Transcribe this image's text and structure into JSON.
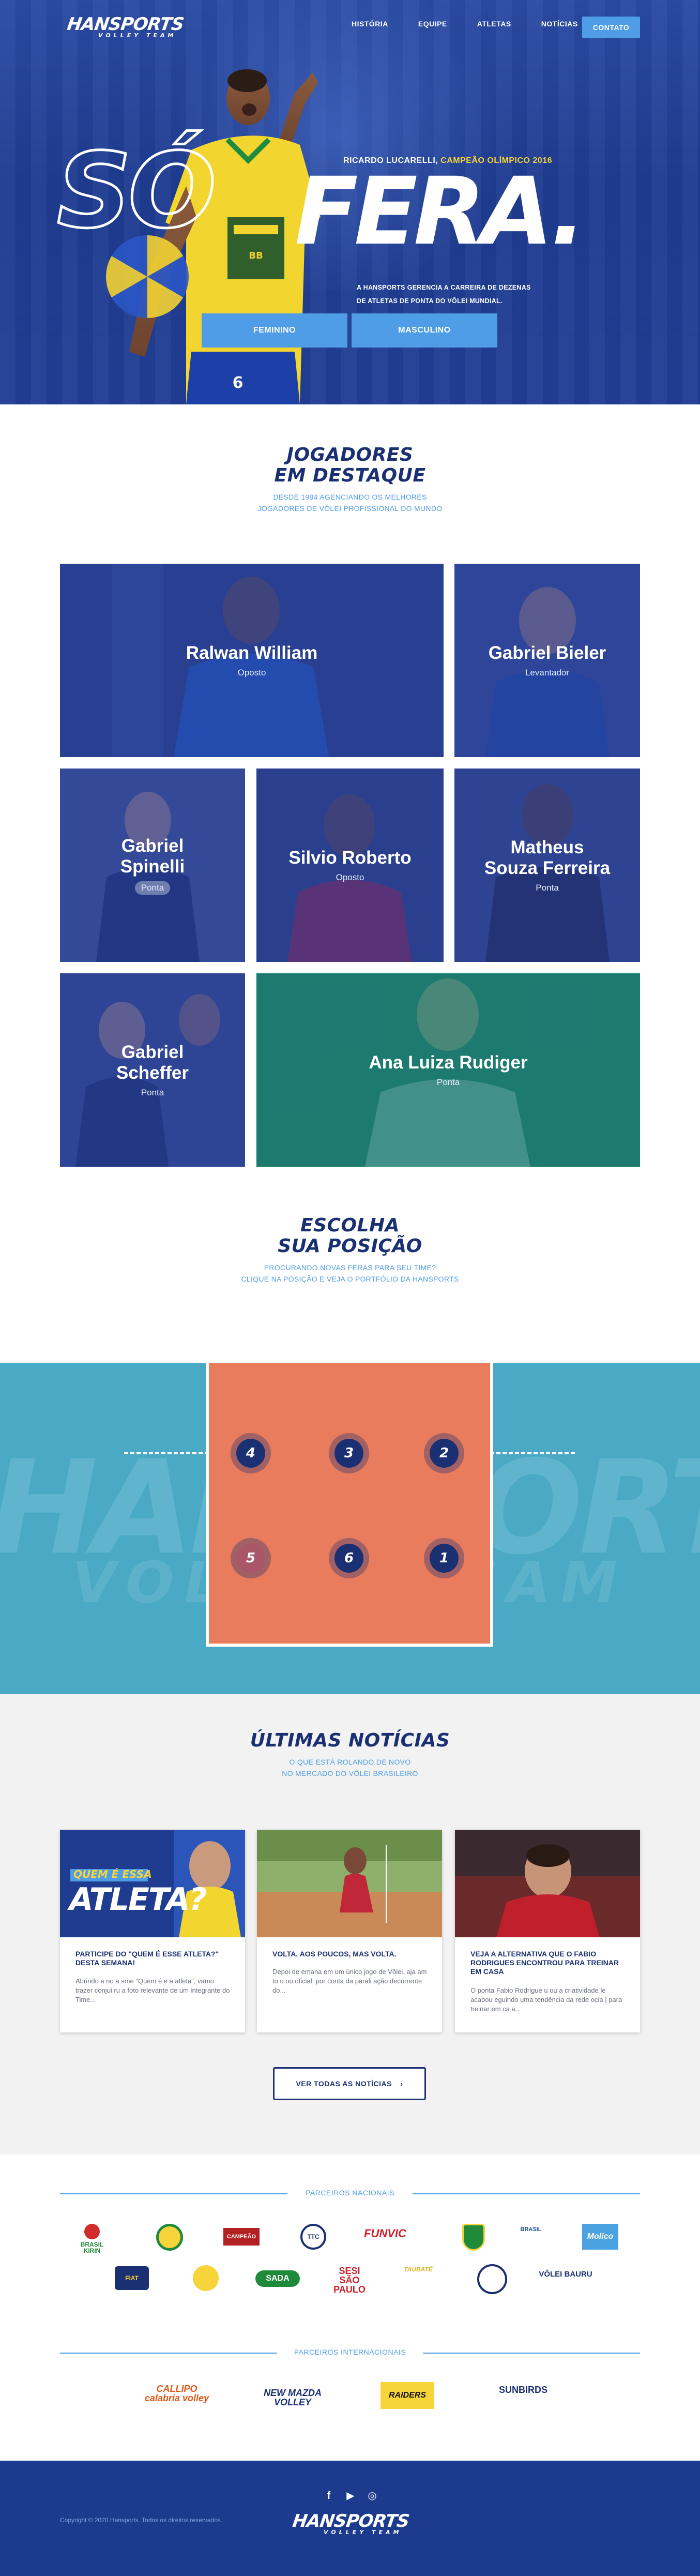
{
  "header": {
    "logo_main": "HANSPORTS",
    "logo_sub": "VOLLEY TEAM",
    "nav": [
      "HISTÓRIA",
      "EQUIPE",
      "ATLETAS",
      "NOTÍCIAS"
    ],
    "contact_label": "CONTATO"
  },
  "hero": {
    "word_outline": "SÓ",
    "word_solid": "FERA.",
    "tag_name": "RICARDO LUCARELLI, ",
    "tag_highlight": "CAMPEÃO OLÍMPICO 2016",
    "description_line1": "A HANSPORTS GERENCIA A CARREIRA DE DEZENAS",
    "description_line2": "DE ATLETAS DE PONTA DO VÔLEI MUNDIAL.",
    "button_female": "FEMININO",
    "button_male": "MASCULINO"
  },
  "featured": {
    "title_line1": "JOGADORES",
    "title_line2": "EM DESTAQUE",
    "subtitle_line1": "DESDE 1994 AGENCIANDO OS MELHORES",
    "subtitle_line2": "JOGADORES DE VÔLEI PROFISSIONAL DO MUNDO",
    "players": [
      {
        "name": "Ralwan William",
        "position": "Oposto"
      },
      {
        "name": "Gabriel Bieler",
        "position": "Levantador"
      },
      {
        "name_line1": "Gabriel",
        "name_line2": "Spinelli",
        "position": "Ponta"
      },
      {
        "name": "Silvio Roberto",
        "position": "Oposto"
      },
      {
        "name_line1": "Matheus",
        "name_line2": "Souza Ferreira",
        "position": "Ponta"
      },
      {
        "name_line1": "Gabriel",
        "name_line2": "Scheffer",
        "position": "Ponta"
      },
      {
        "name": "Ana Luiza Rudiger",
        "position": "Ponta"
      }
    ]
  },
  "positions": {
    "title_line1": "ESCOLHA",
    "title_line2": "SUA POSIÇÃO",
    "subtitle_line1": "PROCURANDO NOVAS FERAS PARA SEU TIME?",
    "subtitle_line2": "CLIQUE NA POSIÇÃO E VEJA O PORTFÓLIO DA HANSPORTS",
    "watermark": "HANSPORTS",
    "watermark_sub": "VOLLEY TEAM",
    "spots": [
      "4",
      "3",
      "2",
      "5",
      "6",
      "1"
    ]
  },
  "news": {
    "title": "ÚLTIMAS NOTÍCIAS",
    "subtitle_line1": "O QUE ESTÁ ROLANDO DE NOVO",
    "subtitle_line2": "NO MERCADO DO VÔLEI BRASILEIRO",
    "items": [
      {
        "img_text_small": "QUEM É ESSA",
        "img_text_big": "ATLETA?",
        "title": "PARTICIPE DO \"QUEM É ESSE ATLETA?\" DESTA SEMANA!",
        "text": "Abrindo a no a sme \"Quem é e a atleta\", vamo trazer conjui ru a foto relevante de um integrante do Time..."
      },
      {
        "title": "VOLTA. AOS POUCOS, MAS VOLTA.",
        "text": "Depoi de emana em um único jogo de Vôlei, aja am to u ou oficial, por conta da parali ação decorrente do..."
      },
      {
        "title": "VEJA A ALTERNATIVA QUE O FABIO RODRIGUES ENCONTROU PARA TREINAR EM CASA",
        "text": "O ponta Fabio Rodrigue u ou a criatividade le acabou eguindo uma tendência da rede ocia | para treinar em ca a..."
      }
    ],
    "see_all": "VER TODAS AS NOTÍCIAS",
    "see_all_icon": "chevron-right-icon"
  },
  "partners": {
    "national_label": "PARCEIROS NACIONAIS",
    "national": [
      "BRASIL KIRIN",
      "CBV",
      "CAMPEÃO",
      "TIJUCA",
      "FUNVIC",
      "ESCUDO",
      "BRASIL",
      "Molico",
      "FIAT",
      "ESTRELA",
      "SADA",
      "SESI SÃO PAULO",
      "TAUBATÉ",
      "MONTES",
      "VÔLEI BAURU"
    ],
    "international_label": "PARCEIROS INTERNACIONAIS",
    "international": [
      "CALLIPO calabria volley",
      "NEW MAZDA VOLLEY",
      "RAIDERS",
      "SUNBIRDS"
    ]
  },
  "footer": {
    "social": [
      "f",
      "▶",
      "◎"
    ],
    "copyright": "Copyright © 2020 Hansports. Todos os direitos reservados.",
    "logo_main": "HANSPORTS",
    "logo_sub": "VOLLEY TEAM"
  },
  "colors": {
    "navy": "#1b2f73",
    "accent_blue": "#4e9de6",
    "hero_blue": "#203e95",
    "court_orange": "#e87c5c",
    "court_bg": "#4aaac6",
    "highlight_yellow": "#f6d43a",
    "card_overlay_green": "#18786e"
  }
}
